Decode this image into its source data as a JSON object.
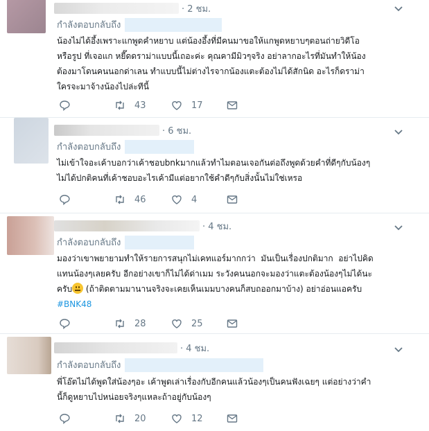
{
  "colors": {
    "link": "#1b95e0",
    "muted": "#657786",
    "divider": "#e6ecf0",
    "handle_bg": "#e3f0fa"
  },
  "tweets": [
    {
      "time": "· 2 ชม.",
      "reply_label": "กำลังตอบกลับถึง",
      "text": "น้องไม่ได้อึ้งเพราะแกพูดคำหยาบ แต่น้องอึ้งที่มีคนมาขอให้แกพูดหยาบๆตอนถ่ายวิดีโอ\nหรือรูป ที่เจอแก หยี๊ดดราม่าแบบนี้เถอะค่ะ คุณคามีมิวๆจริง อย่าลากอะไรที่มันทำให้น้อง\nต้องมาโดนคนนอกด่าเลน ทำแบบนี้ไม่ต่างไรจากน้องแตะต้องไม่ได้สักนิด อะไรก็ดราม่า\nใครจะมาจ้างน้องไปล่ะทีนี้",
      "retweets": "43",
      "likes": "17"
    },
    {
      "time": "· 6 ชม.",
      "reply_label": "กำลังตอบกลับถึง",
      "text": "ไม่เข้าใจอะเค้าบอกว่าเค้าชอบbnkมากแล้วทำไมตอนเจอกันต่อถึงพูดด้วยคำที่ดีๆกับน้องๆ\nไม่ได้ปกติคนที่เค้าชอบอะไรเค้ามีแต่อยากใช้คำดีๆกับสิ่งนั้นไม่ใช่เหรอ",
      "retweets": "46",
      "likes": "4"
    },
    {
      "time": "· 4 ชม.",
      "reply_label": "กำลังตอบกลับถึง",
      "text_a": "มองว่าเขาพยายามทำให้รายการสนุกไม่เคทแอร์มากกว่า  มันเป็นเรื่องปกติมาก  อย่าไปคิด\nแทนน้องๆเลยครับ อีกอย่างเขาก็ไม่ได้ด่าเมม ระวังคนนอกจะมองว่าแตะต้องน้องๆไม่ได้นะ\nครับ",
      "text_b": " (ถ้าติดตามมานานจริงจะเคยเห็นเมมบางคนก็สบถออกมาบ้าง) อย่าอ่อนแอครับ",
      "hashtag": "#BNK48",
      "retweets": "28",
      "likes": "25"
    },
    {
      "time": "· 4 ชม.",
      "reply_label": "กำลังตอบกลับถึง",
      "text": "พี่โอ๊ตไม่ได้พูดใส่น้องๆอะ เค้าพูดเล่าเรื่องกับอีกคนแล้วน้องๆเป็นคนฟังเฉยๆ แต่อย่างว่าคำ\nนี้ก็ดูหยาบไปหน่อยจริงๆแหละถ้าอยู่กับน้องๆ",
      "retweets": "20",
      "likes": "12"
    }
  ]
}
